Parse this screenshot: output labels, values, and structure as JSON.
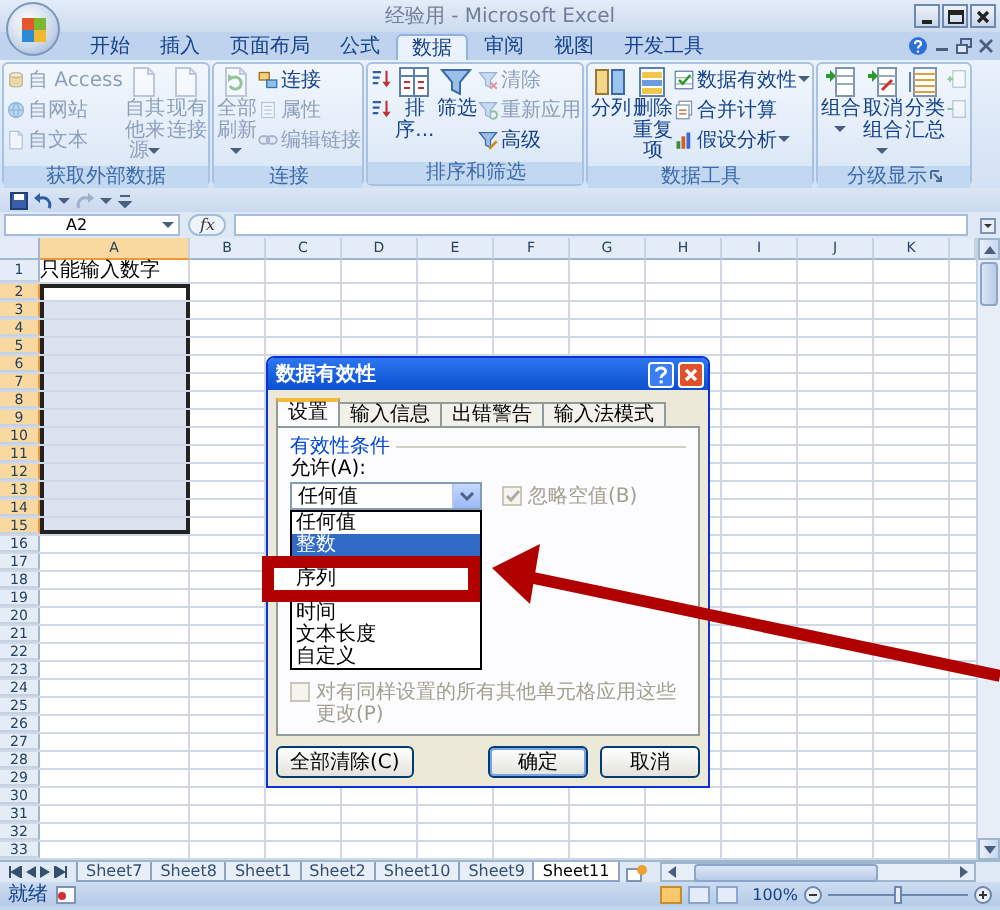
{
  "window": {
    "title": "经验用 - Microsoft Excel"
  },
  "ribbon_tabs": [
    {
      "label": "开始",
      "selected": false
    },
    {
      "label": "插入",
      "selected": false
    },
    {
      "label": "页面布局",
      "selected": false
    },
    {
      "label": "公式",
      "selected": false
    },
    {
      "label": "数据",
      "selected": true
    },
    {
      "label": "审阅",
      "selected": false
    },
    {
      "label": "视图",
      "selected": false
    },
    {
      "label": "开发工具",
      "selected": false
    }
  ],
  "ribbon_groups": [
    {
      "title": "获取外部数据",
      "launcher": false,
      "items": [
        {
          "kind": "small-stack",
          "items": [
            {
              "label": "自 Access",
              "disabled": true,
              "dropdown": false
            },
            {
              "label": "自网站",
              "disabled": true,
              "dropdown": false
            },
            {
              "label": "自文本",
              "disabled": true,
              "dropdown": false
            }
          ]
        },
        {
          "kind": "large",
          "label": "自其他来源",
          "disabled": true,
          "dropdown": true
        },
        {
          "kind": "large",
          "label": "现有连接",
          "disabled": true,
          "dropdown": false
        }
      ]
    },
    {
      "title": "连接",
      "launcher": false,
      "items": [
        {
          "kind": "large",
          "label": "全部刷新",
          "disabled": true,
          "dropdown": true
        },
        {
          "kind": "small-stack",
          "items": [
            {
              "label": "连接",
              "disabled": false,
              "dropdown": false
            },
            {
              "label": "属性",
              "disabled": true,
              "dropdown": false
            },
            {
              "label": "编辑链接",
              "disabled": true,
              "dropdown": false
            }
          ]
        }
      ]
    },
    {
      "title": "排序和筛选",
      "launcher": false,
      "items": [
        {
          "kind": "icon-stack",
          "items": [
            {
              "disabled": false
            },
            {
              "disabled": false
            }
          ]
        },
        {
          "kind": "large",
          "label": "排序...",
          "disabled": false,
          "dropdown": false
        },
        {
          "kind": "large",
          "label": "筛选",
          "disabled": false,
          "dropdown": false
        },
        {
          "kind": "small-stack",
          "items": [
            {
              "label": "清除",
              "disabled": true,
              "dropdown": false
            },
            {
              "label": "重新应用",
              "disabled": true,
              "dropdown": false
            },
            {
              "label": "高级",
              "disabled": false,
              "dropdown": false
            }
          ]
        }
      ]
    },
    {
      "title": "数据工具",
      "launcher": false,
      "items": [
        {
          "kind": "large",
          "label": "分列",
          "disabled": false,
          "dropdown": false
        },
        {
          "kind": "large",
          "label": "删除重复项",
          "disabled": false,
          "dropdown": false
        },
        {
          "kind": "small-stack",
          "items": [
            {
              "label": "数据有效性",
              "disabled": false,
              "dropdown": true
            },
            {
              "label": "合并计算",
              "disabled": false,
              "dropdown": false
            },
            {
              "label": "假设分析",
              "disabled": false,
              "dropdown": true
            }
          ]
        }
      ]
    },
    {
      "title": "分级显示",
      "launcher": true,
      "items": [
        {
          "kind": "large",
          "label": "组合",
          "disabled": false,
          "dropdown": true
        },
        {
          "kind": "large",
          "label": "取消组合",
          "disabled": false,
          "dropdown": true
        },
        {
          "kind": "large",
          "label": "分类汇总",
          "disabled": false,
          "dropdown": false
        },
        {
          "kind": "icon-stack",
          "items": [
            {
              "disabled": true
            },
            {
              "disabled": true
            }
          ]
        }
      ]
    }
  ],
  "name_box": "A2",
  "function_label": "fx",
  "columns": [
    {
      "label": "A",
      "selected": true
    },
    {
      "label": "B",
      "selected": false
    },
    {
      "label": "C",
      "selected": false
    },
    {
      "label": "D",
      "selected": false
    },
    {
      "label": "E",
      "selected": false
    },
    {
      "label": "F",
      "selected": false
    },
    {
      "label": "G",
      "selected": false
    },
    {
      "label": "H",
      "selected": false
    },
    {
      "label": "I",
      "selected": false
    },
    {
      "label": "J",
      "selected": false
    },
    {
      "label": "K",
      "selected": false
    }
  ],
  "rows": [
    {
      "header": "1",
      "selected": false,
      "a": "只能输入数字"
    },
    {
      "header": "2",
      "selected": true
    },
    {
      "header": "3",
      "selected": true
    },
    {
      "header": "4",
      "selected": true
    },
    {
      "header": "5",
      "selected": true
    },
    {
      "header": "6",
      "selected": true
    },
    {
      "header": "7",
      "selected": true
    },
    {
      "header": "8",
      "selected": true
    },
    {
      "header": "9",
      "selected": true
    },
    {
      "header": "10",
      "selected": true
    },
    {
      "header": "11",
      "selected": true
    },
    {
      "header": "12",
      "selected": true
    },
    {
      "header": "13",
      "selected": true
    },
    {
      "header": "14",
      "selected": true
    },
    {
      "header": "15",
      "selected": true
    },
    {
      "header": "16",
      "selected": false
    },
    {
      "header": "17",
      "selected": false
    },
    {
      "header": "18",
      "selected": false
    },
    {
      "header": "19",
      "selected": false
    },
    {
      "header": "20",
      "selected": false
    },
    {
      "header": "21",
      "selected": false
    },
    {
      "header": "22",
      "selected": false
    },
    {
      "header": "23",
      "selected": false
    },
    {
      "header": "24",
      "selected": false
    },
    {
      "header": "25",
      "selected": false
    },
    {
      "header": "26",
      "selected": false
    },
    {
      "header": "27",
      "selected": false
    },
    {
      "header": "28",
      "selected": false
    },
    {
      "header": "29",
      "selected": false
    },
    {
      "header": "30",
      "selected": false
    },
    {
      "header": "31",
      "selected": false
    },
    {
      "header": "32",
      "selected": false
    },
    {
      "header": "33",
      "selected": false
    }
  ],
  "sheet_tabs": [
    {
      "label": "Sheet7",
      "selected": false
    },
    {
      "label": "Sheet8",
      "selected": false
    },
    {
      "label": "Sheet1",
      "selected": false
    },
    {
      "label": "Sheet2",
      "selected": false
    },
    {
      "label": "Sheet10",
      "selected": false
    },
    {
      "label": "Sheet9",
      "selected": false
    },
    {
      "label": "Sheet11",
      "selected": true
    }
  ],
  "status_bar": {
    "text": "就绪",
    "views": [
      {
        "selected": true
      },
      {
        "selected": false
      },
      {
        "selected": false
      }
    ],
    "zoom": "100%",
    "level": 0.5
  },
  "dialog": {
    "title": "数据有效性",
    "tabs": [
      {
        "label": "设置",
        "selected": true
      },
      {
        "label": "输入信息",
        "selected": false
      },
      {
        "label": "出错警告",
        "selected": false
      },
      {
        "label": "输入法模式",
        "selected": false
      }
    ],
    "group_label": "有效性条件",
    "allow_label": "允许(A):",
    "allow_value": "任何值",
    "ignore_blank": {
      "label": "忽略空值(B)",
      "checked": true,
      "disabled": true
    },
    "options": [
      {
        "label": "任何值",
        "selected": false,
        "highlighted": false
      },
      {
        "label": "整数",
        "selected": true,
        "highlighted": false
      },
      {
        "label": "序列",
        "selected": false,
        "highlighted": true
      },
      {
        "label": "时间",
        "selected": false,
        "highlighted": false
      },
      {
        "label": "文本长度",
        "selected": false,
        "highlighted": false
      },
      {
        "label": "自定义",
        "selected": false,
        "highlighted": false
      }
    ],
    "apply_all": {
      "label": "对有同样设置的所有其他单元格应用这些更改(P)",
      "checked": false,
      "disabled": true
    },
    "buttons": [
      {
        "label": "全部清除(C)",
        "kind": "clear"
      },
      {
        "label": "确定",
        "kind": "default"
      },
      {
        "label": "取消",
        "kind": "normal"
      }
    ]
  }
}
